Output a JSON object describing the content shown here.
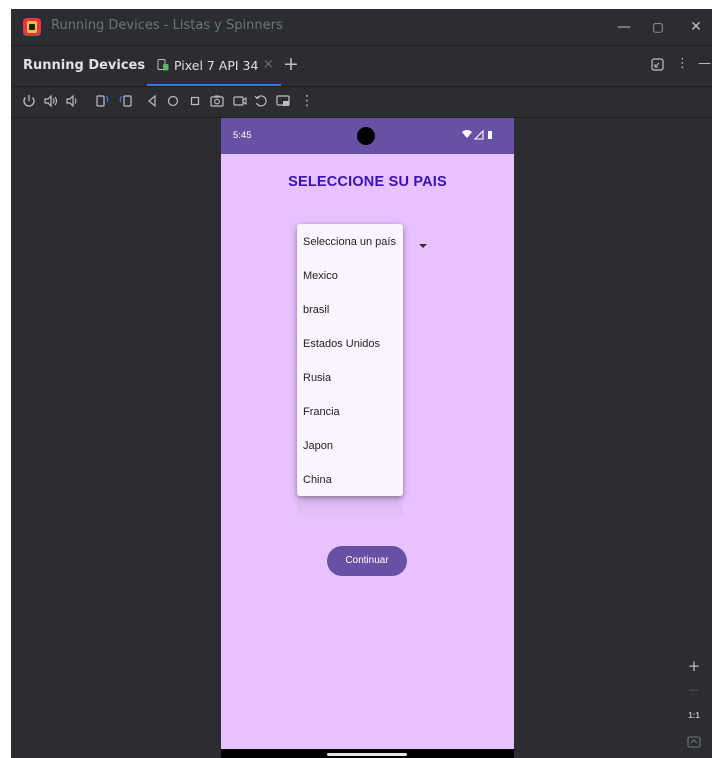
{
  "window": {
    "title": "Running Devices - Listas y Spinners",
    "controls": {
      "minimize": "—",
      "maximize": "▢",
      "close": "✕"
    }
  },
  "tabbar": {
    "panel_title": "Running Devices",
    "tab_label": "Pixel 7 API 34",
    "tab_close": "×",
    "add_tab": "+",
    "overflow": "⋮",
    "hide": "—"
  },
  "device_toolbar": {
    "icons": [
      "power-icon",
      "volume-up-icon",
      "volume-down-icon",
      "rotate-left-icon",
      "rotate-right-icon",
      "back-icon",
      "home-icon",
      "overview-icon",
      "screenshot-icon",
      "screen-record-icon",
      "reset-icon",
      "snapshot-icon",
      "more-icon"
    ]
  },
  "device": {
    "status_time": "5:45",
    "app_title": "SELECCIONE SU PAIS",
    "spinner": {
      "selected": "Selecciona un país",
      "options": [
        "Selecciona un país",
        "Mexico",
        "brasil",
        "Estados Unidos",
        "Rusia",
        "Francia",
        "Japon",
        "China"
      ]
    },
    "continue_label": "Continuar"
  },
  "zoom": {
    "plus": "+",
    "minus": "—",
    "one_to_one": "1:1"
  },
  "colors": {
    "ide_bg": "#2b2d30",
    "accent": "#3574f0",
    "status_bar": "#6751a4",
    "app_bg": "#e7c2fe",
    "title_color": "#3a12b3",
    "button": "#6751a4"
  }
}
